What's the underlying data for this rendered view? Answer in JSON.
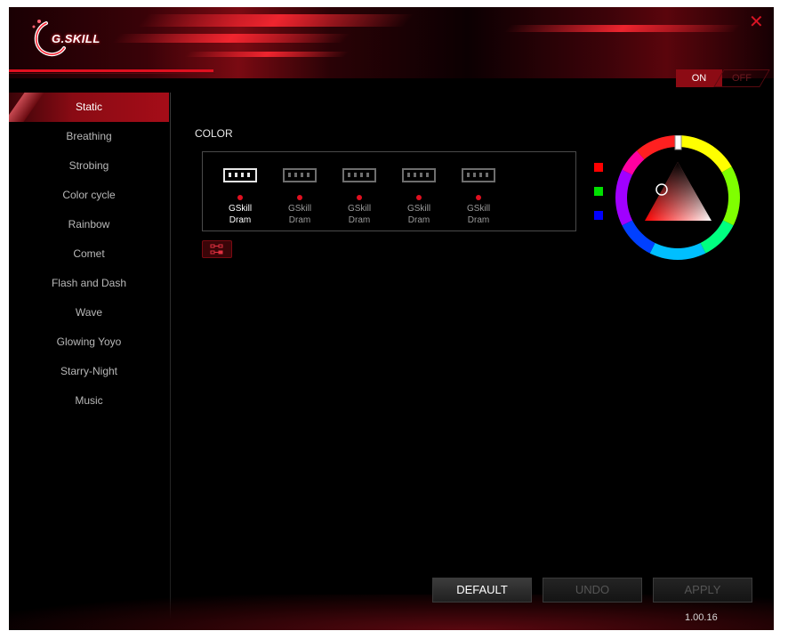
{
  "header": {
    "logo_text": "G.SKILL",
    "close_symbol": "✕"
  },
  "power": {
    "on_label": "ON",
    "off_label": "OFF",
    "state": "on"
  },
  "sidebar": {
    "items": [
      {
        "label": "Static",
        "active": true
      },
      {
        "label": "Breathing"
      },
      {
        "label": "Strobing"
      },
      {
        "label": "Color cycle"
      },
      {
        "label": "Rainbow"
      },
      {
        "label": "Comet"
      },
      {
        "label": "Flash and Dash"
      },
      {
        "label": "Wave"
      },
      {
        "label": "Glowing Yoyo"
      },
      {
        "label": "Starry-Night"
      },
      {
        "label": "Music"
      }
    ]
  },
  "main": {
    "color_label": "COLOR",
    "drams": [
      {
        "line1": "GSkill",
        "line2": "Dram",
        "selected": true
      },
      {
        "line1": "GSkill",
        "line2": "Dram"
      },
      {
        "line1": "GSkill",
        "line2": "Dram"
      },
      {
        "line1": "GSkill",
        "line2": "Dram"
      },
      {
        "line1": "GSkill",
        "line2": "Dram"
      }
    ],
    "link_icon": "link-modules-icon"
  },
  "swatches": [
    {
      "name": "red",
      "color": "#ff0000"
    },
    {
      "name": "green",
      "color": "#00e000"
    },
    {
      "name": "blue",
      "color": "#0000ff"
    }
  ],
  "colors": {
    "accent": "#e01020",
    "selected_color": "#ff0000"
  },
  "buttons": {
    "default": "DEFAULT",
    "undo": "UNDO",
    "apply": "APPLY"
  },
  "version": "1.00.16"
}
